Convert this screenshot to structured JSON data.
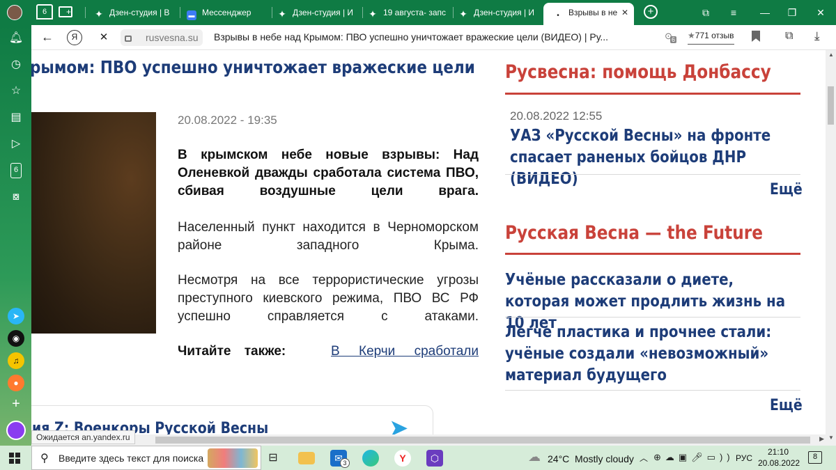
{
  "browser": {
    "tab_counter": "6",
    "tabs": [
      {
        "label": "Дзен-студия | В"
      },
      {
        "label": "Мессенджер"
      },
      {
        "label": "Дзен-студия | И"
      },
      {
        "label": "19 августа- запс"
      },
      {
        "label": "Дзен-студия | И"
      },
      {
        "label": "Взрывы в не"
      }
    ],
    "address": {
      "domain": "rusvesna.su",
      "page_title": "Взрывы в небе над Крымом: ПВО успешно уничтожает вражеские цели (ВИДЕО) | Ру...",
      "reviews": "771 отзыв",
      "badge_count": "6"
    },
    "sidebar_badge": "6",
    "status_url": "Ожидается an.yandex.ru"
  },
  "article": {
    "headline_partial": "рымом: ПВО успешно уничтожает вражеские цели",
    "date": "20.08.2022 - 19:35",
    "lead": "В крымском небе новые взрывы: Над Оленевкой дважды сработала система ПВО, сбивая воздушные цели врага.",
    "para1": "Населенный пункт находится в Черноморском районе западного Крыма.",
    "para2": "Несмотря на все террористические угрозы преступного киевского режима, ПВО ВС РФ успешно справляется с атаками.",
    "read_also_label": "Читайте также:",
    "read_also_link": "В Керчи сработали",
    "telegram_promo": "ия Z: Военкоры Русской Весны"
  },
  "right_column": {
    "section1": {
      "title": "Русвесна: помощь Донбассу",
      "items": [
        {
          "date": "20.08.2022 12:55",
          "title": "УАЗ «Русской Весны» на фронте спасает раненых бойцов ДНР (ВИДЕО)"
        }
      ],
      "more": "Ещё"
    },
    "section2": {
      "title": "Русская Весна — the Future",
      "items": [
        {
          "title": "Учёные рассказали о диете, которая может продлить жизнь на 10 лет"
        },
        {
          "title": "Легче пластика и прочнее стали: учёные создали «невозможный» материал будущего"
        }
      ],
      "more": "Ещё"
    }
  },
  "taskbar": {
    "search_placeholder": "Введите здесь текст для поиска",
    "mail_badge": "3",
    "weather": "24°C  Mostly cloudy",
    "lang": "РУС",
    "time": "21:10",
    "date": "20.08.2022",
    "notif_count": "8"
  },
  "colors": {
    "browser_green": "#0f7b44",
    "headline_blue": "#1d3c78",
    "section_red": "#c9423a"
  }
}
